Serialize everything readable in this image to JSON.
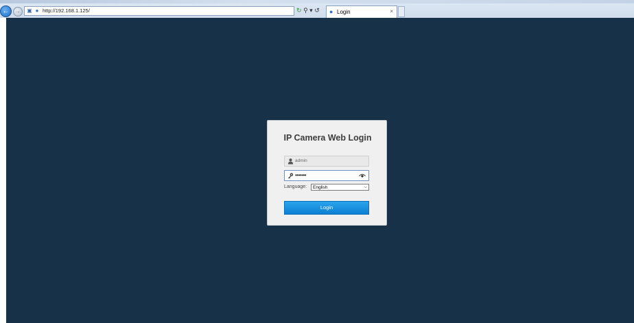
{
  "browser": {
    "url": "http://192.168.1.125/",
    "tab_title": "Login",
    "tab_close": "×"
  },
  "login": {
    "title": "IP Camera Web Login",
    "username_value": "admin",
    "password_value": "•••••••",
    "language_label": "Language:",
    "language_selected": "English",
    "login_button": "Login"
  },
  "icons": {
    "back": "back-arrow-icon",
    "forward": "forward-arrow-icon",
    "user": "user-icon",
    "key": "key-icon",
    "eye": "eye-icon",
    "dropdown": "chevron-down-icon"
  },
  "colors": {
    "page_background": "#173248",
    "card_background": "#f0f0f0",
    "button_blue": "#1a8fdf"
  }
}
